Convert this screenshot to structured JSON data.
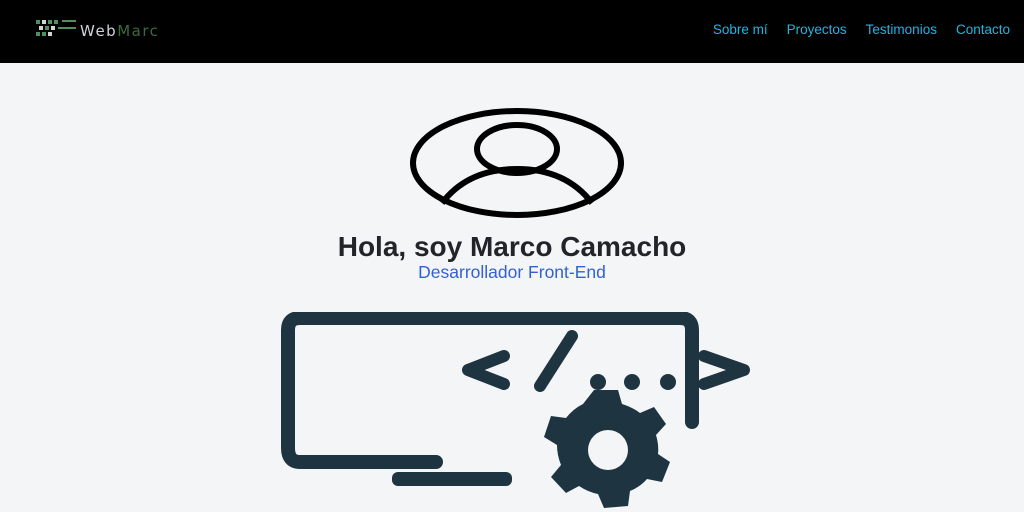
{
  "brand": {
    "name_part1": "Web",
    "name_part2": "Marc"
  },
  "nav": {
    "items": [
      {
        "label": "Sobre mí"
      },
      {
        "label": "Proyectos"
      },
      {
        "label": "Testimonios"
      },
      {
        "label": "Contacto"
      }
    ]
  },
  "hero": {
    "greeting": "Hola, soy Marco Camacho",
    "role": "Desarrollador Front-End"
  },
  "colors": {
    "navbar_bg": "#000000",
    "nav_link": "#1fb6e0",
    "role_text": "#3160d8",
    "illustration": "#1f3441",
    "page_bg": "#f4f5f7"
  }
}
